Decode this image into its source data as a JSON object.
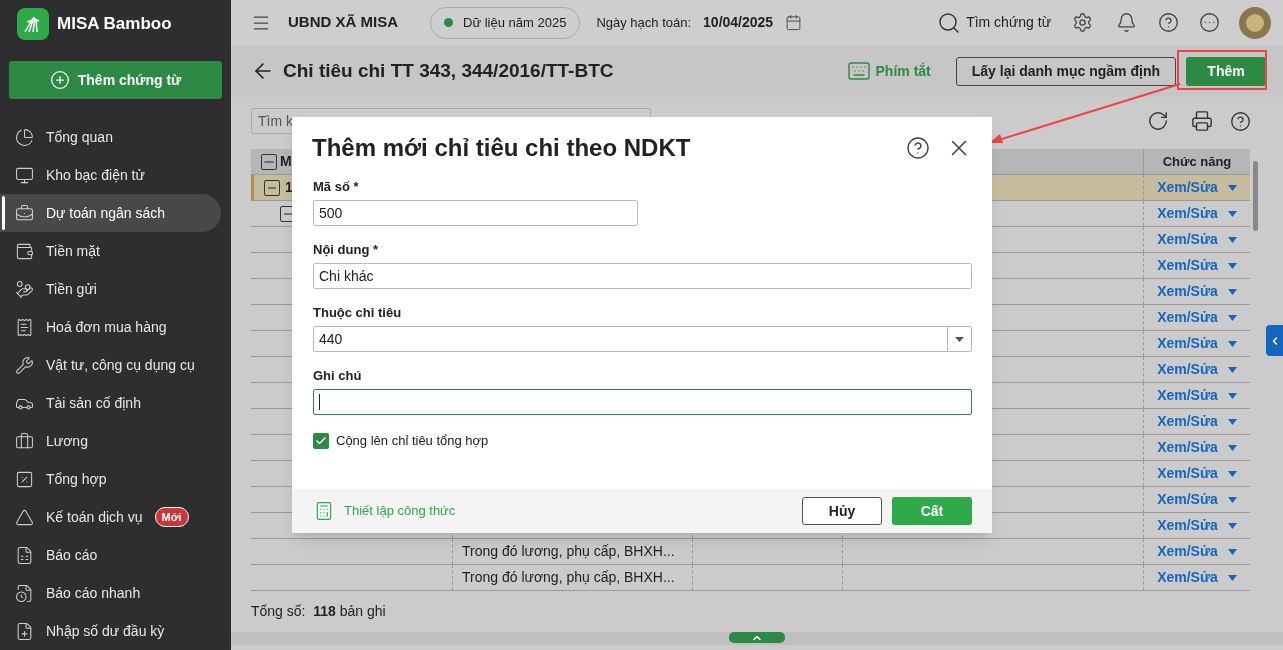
{
  "app": {
    "name": "MISA Bamboo",
    "new_button": "Thêm chứng từ"
  },
  "sidebar": {
    "items": [
      {
        "label": "Tổng quan",
        "selected": false
      },
      {
        "label": "Kho bạc điện tử",
        "selected": false
      },
      {
        "label": "Dự toán ngân sách",
        "selected": true
      },
      {
        "label": "Tiền mặt",
        "selected": false
      },
      {
        "label": "Tiền gửi",
        "selected": false
      },
      {
        "label": "Hoá đơn mua hàng",
        "selected": false
      },
      {
        "label": "Vật tư, công cụ dụng cụ",
        "selected": false
      },
      {
        "label": "Tài sản cố định",
        "selected": false
      },
      {
        "label": "Lương",
        "selected": false
      },
      {
        "label": "Tổng hợp",
        "selected": false
      },
      {
        "label": "Kế toán dịch vụ",
        "selected": false,
        "badge": "Mới"
      },
      {
        "label": "Báo cáo",
        "selected": false
      },
      {
        "label": "Báo cáo nhanh",
        "selected": false
      },
      {
        "label": "Nhập số dư đầu kỳ",
        "selected": false
      }
    ]
  },
  "header": {
    "org": "UBND XÃ MISA",
    "data_year": "Dữ liệu năm 2025",
    "date_label": "Ngày hạch toán:",
    "date": "10/04/2025",
    "search": "Tìm chứng từ"
  },
  "page": {
    "title": "Chỉ tiêu chi TT 343, 344/2016/TT-BTC",
    "shortcuts": "Phím tắt",
    "reset_button": "Lấy lại danh mục ngầm định",
    "add_button": "Thêm",
    "search_placeholder": "Tìm k"
  },
  "table": {
    "first_column": "M",
    "action_column": "Chức năng",
    "rows": [
      {
        "code": "1",
        "selected": true,
        "expanded": true,
        "action": "Xem/Sửa",
        "children": [
          {
            "selected": false,
            "expanded": true,
            "action": "Xem/Sửa",
            "children": [
              {
                "selected": false,
                "action": "Xem/Sửa"
              },
              {
                "selected": false,
                "action": "Xem/Sửa"
              },
              {
                "selected": false,
                "action": "Xem/Sửa"
              },
              {
                "selected": false,
                "action": "Xem/Sửa"
              },
              {
                "selected": false,
                "action": "Xem/Sửa"
              },
              {
                "selected": false,
                "action": "Xem/Sửa"
              },
              {
                "selected": false,
                "action": "Xem/Sửa"
              },
              {
                "selected": false,
                "action": "Xem/Sửa"
              },
              {
                "selected": false,
                "action": "Xem/Sửa"
              },
              {
                "selected": false,
                "action": "Xem/Sửa"
              },
              {
                "selected": false,
                "action": "Xem/Sửa"
              },
              {
                "selected": false,
                "action": "Xem/Sửa"
              },
              {
                "selected": false,
                "name": "Trong đó lương, phụ cấp, BHXH...",
                "action": "Xem/Sửa"
              },
              {
                "selected": false,
                "name": "Trong đó lương, phụ cấp, BHXH...",
                "action": "Xem/Sửa"
              }
            ]
          }
        ]
      }
    ]
  },
  "footer": {
    "total_label": "Tổng số:",
    "total": "118",
    "total_unit": "bản ghi"
  },
  "dialog": {
    "title": "Thêm mới chỉ tiêu chi theo NDKT",
    "fields": [
      {
        "label": "Mã số *",
        "value": "500",
        "kind": "short",
        "focused": false
      },
      {
        "label": "Nội dung *",
        "value": "Chi khác",
        "kind": "text",
        "focused": false
      },
      {
        "label": "Thuộc chỉ tiêu",
        "value": "440",
        "kind": "select",
        "focused": false
      },
      {
        "label": "Ghi chú",
        "kind": "text",
        "focused": true
      }
    ],
    "checkbox": {
      "label": "Cộng lên chỉ tiêu tổng hợp",
      "checked": true
    },
    "formula_link": "Thiết lập công thức",
    "cancel_button": "Hủy",
    "save_button": "Cất"
  }
}
